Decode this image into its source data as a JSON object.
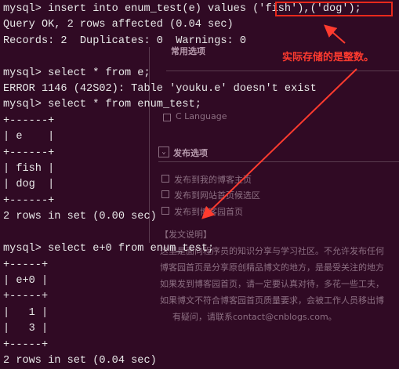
{
  "terminal": {
    "lines": [
      "mysql> insert into enum_test(e) values ('fish'),('dog');",
      "Query OK, 2 rows affected (0.04 sec)",
      "Records: 2  Duplicates: 0  Warnings: 0",
      "",
      "mysql> select * from e;",
      "ERROR 1146 (42S02): Table 'youku.e' doesn't exist",
      "mysql> select * from enum_test;",
      "+------+",
      "| e    |",
      "+------+",
      "| fish |",
      "| dog  |",
      "+------+",
      "2 rows in set (0.00 sec)",
      "",
      "mysql> select e+0 from enum_test;",
      "+-----+",
      "| e+0 |",
      "+-----+",
      "|   1 |",
      "|   3 |",
      "+-----+",
      "2 rows in set (0.04 sec)"
    ]
  },
  "annotation": {
    "note": "实际存储的是整数。",
    "color": "#ff3b2f"
  },
  "background_page": {
    "section_common": "常用选项",
    "c_language": "C Language",
    "section_publish": "发布选项",
    "publish_home": "发布到我的博客主页",
    "publish_candidate": "发布到网站首页候选区",
    "publish_frontpage": "发布到博客园首页",
    "explain_title": "【发文说明】",
    "explain_1": "这里是面向程序员的知识分享与学习社区。不允许发布任何",
    "explain_2": "博客园首页是分享原创精品博文的地方，是最受关注的地方",
    "explain_3": "如果发到博客园首页，请一定要认真对待，多花一些工夫，",
    "explain_4": "如果博文不符合博客园首页质量要求，会被工作人员移出博",
    "explain_5": "有疑问，请联系contact@cnblogs.com。"
  }
}
